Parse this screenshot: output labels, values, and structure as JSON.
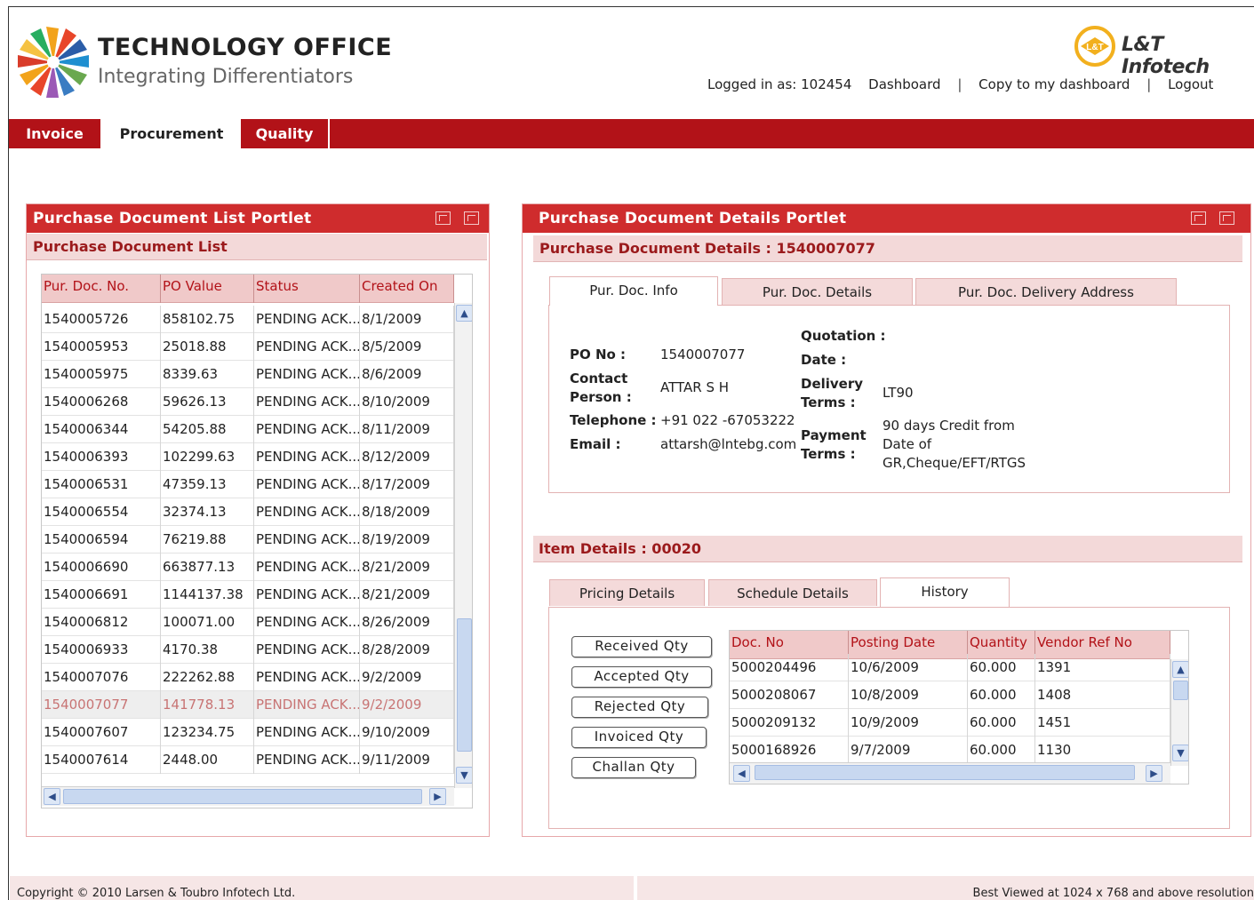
{
  "brand": {
    "title": "TECHNOLOGY OFFICE",
    "subtitle": "Integrating Differentiators",
    "partner": "L&T Infotech",
    "logo_icon": "pinwheel-logo",
    "partner_icon": "lt-circle-logo"
  },
  "toplinks": {
    "logged_in": "Logged in as: 102454",
    "dashboard": "Dashboard",
    "copy": "Copy to my dashboard",
    "logout": "Logout",
    "sep": "|"
  },
  "nav": {
    "invoice": "Invoice",
    "procurement": "Procurement",
    "quality": "Quality",
    "active": "Procurement"
  },
  "colors": {
    "brand_red": "#b21218",
    "portlet_red": "#cf2c2d",
    "subhead_bg": "#f3d9d9"
  },
  "list_portlet": {
    "title": "Purchase Document List Portlet",
    "subtitle": "Purchase Document List",
    "columns": [
      "Pur. Doc. No.",
      "PO Value",
      "Status",
      "Created On"
    ],
    "rows": [
      [
        "1540005726",
        "858102.75",
        "PENDING ACK...",
        "8/1/2009"
      ],
      [
        "1540005953",
        "25018.88",
        "PENDING ACK...",
        "8/5/2009"
      ],
      [
        "1540005975",
        "8339.63",
        "PENDING ACK...",
        "8/6/2009"
      ],
      [
        "1540006268",
        "59626.13",
        "PENDING ACK...",
        "8/10/2009"
      ],
      [
        "1540006344",
        "54205.88",
        "PENDING ACK...",
        "8/11/2009"
      ],
      [
        "1540006393",
        "102299.63",
        "PENDING ACK...",
        "8/12/2009"
      ],
      [
        "1540006531",
        "47359.13",
        "PENDING ACK...",
        "8/17/2009"
      ],
      [
        "1540006554",
        "32374.13",
        "PENDING ACK...",
        "8/18/2009"
      ],
      [
        "1540006594",
        "76219.88",
        "PENDING ACK...",
        "8/19/2009"
      ],
      [
        "1540006690",
        "663877.13",
        "PENDING ACK...",
        "8/21/2009"
      ],
      [
        "1540006691",
        "1144137.38",
        "PENDING ACK...",
        "8/21/2009"
      ],
      [
        "1540006812",
        "100071.00",
        "PENDING ACK...",
        "8/26/2009"
      ],
      [
        "1540006933",
        "4170.38",
        "PENDING ACK...",
        "8/28/2009"
      ],
      [
        "1540007076",
        "222262.88",
        "PENDING ACK...",
        "9/2/2009"
      ],
      [
        "1540007077",
        "141778.13",
        "PENDING ACK...",
        "9/2/2009"
      ],
      [
        "1540007607",
        "123234.75",
        "PENDING ACK...",
        "9/10/2009"
      ],
      [
        "1540007614",
        "2448.00",
        "PENDING ACK...",
        "9/11/2009"
      ]
    ],
    "selected_row": 14
  },
  "details_portlet": {
    "title": "Purchase Document Details Portlet",
    "subtitle": "Purchase Document Details : 1540007077",
    "tabs": [
      "Pur. Doc. Info",
      "Pur. Doc. Details",
      "Pur. Doc. Delivery Address"
    ],
    "active_tab": "Pur. Doc. Info",
    "info": {
      "po_no_label": "PO No :",
      "po_no": "1540007077",
      "contact_label_1": "Contact",
      "contact_label_2": "Person :",
      "contact": "ATTAR S H",
      "telephone_label": "Telephone :",
      "telephone": "+91 022 -67053222",
      "email_label": "Email :",
      "email": "attarsh@lntebg.com",
      "quotation_label": "Quotation :",
      "date_label": "Date :",
      "delivery_label_1": "Delivery",
      "delivery_label_2": "Terms :",
      "delivery": "LT90",
      "payment_label_1": "Payment",
      "payment_label_2": "Terms :",
      "payment_1": "90 days Credit from",
      "payment_2": "Date of",
      "payment_3": "GR,Cheque/EFT/RTGS"
    },
    "item_head": "Item Details : 00020",
    "item_tabs": [
      "Pricing Details",
      "Schedule Details",
      "History"
    ],
    "active_item_tab": "History",
    "qty_buttons": [
      "Received Qty",
      "Accepted Qty",
      "Rejected Qty",
      "Invoiced Qty",
      "Challan Qty"
    ],
    "history": {
      "columns": [
        "Doc. No",
        "Posting Date",
        "Quantity",
        "Vendor Ref No"
      ],
      "rows": [
        [
          "5000204496",
          "10/6/2009",
          "60.000",
          "1391"
        ],
        [
          "5000208067",
          "10/8/2009",
          "60.000",
          "1408"
        ],
        [
          "5000209132",
          "10/9/2009",
          "60.000",
          "1451"
        ],
        [
          "5000168926",
          "9/7/2009",
          "60.000",
          "1130"
        ]
      ]
    }
  },
  "footer": {
    "copyright": "Copyright © 2010 Larsen & Toubro Infotech Ltd.",
    "resolution": "Best Viewed at 1024 x 768 and above resolution"
  }
}
